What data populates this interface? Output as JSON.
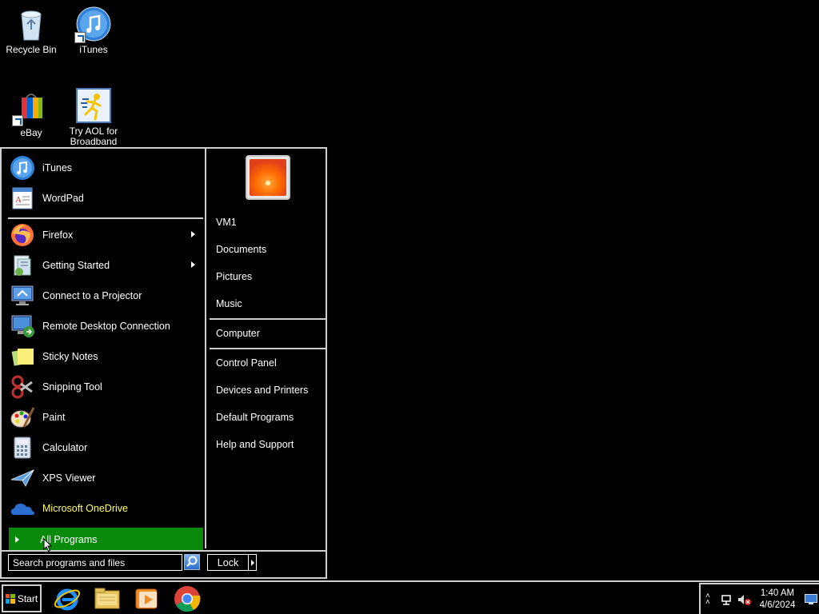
{
  "desktop": {
    "icons": [
      {
        "label": "Recycle Bin",
        "icon": "recycle-bin-icon"
      },
      {
        "label": "iTunes",
        "icon": "itunes-icon"
      },
      {
        "label": "eBay",
        "icon": "ebay-icon"
      },
      {
        "label": "Try AOL for Broadband",
        "icon": "aol-icon"
      }
    ]
  },
  "start_menu": {
    "pinned": [
      {
        "label": "iTunes",
        "icon": "itunes-icon"
      },
      {
        "label": "WordPad",
        "icon": "wordpad-icon"
      }
    ],
    "recent": [
      {
        "label": "Firefox",
        "icon": "firefox-icon",
        "submenu": true
      },
      {
        "label": "Getting Started",
        "icon": "getting-started-icon",
        "submenu": true
      },
      {
        "label": "Connect to a Projector",
        "icon": "projector-icon",
        "submenu": false
      },
      {
        "label": "Remote Desktop Connection",
        "icon": "remote-desktop-icon",
        "submenu": false
      },
      {
        "label": "Sticky Notes",
        "icon": "sticky-notes-icon",
        "submenu": false
      },
      {
        "label": "Snipping Tool",
        "icon": "snipping-tool-icon",
        "submenu": false
      },
      {
        "label": "Paint",
        "icon": "paint-icon",
        "submenu": false
      },
      {
        "label": "Calculator",
        "icon": "calculator-icon",
        "submenu": false
      },
      {
        "label": "XPS Viewer",
        "icon": "xps-viewer-icon",
        "submenu": false
      },
      {
        "label": "Microsoft OneDrive",
        "icon": "onedrive-icon",
        "submenu": false,
        "highlight_color": "#ffff66"
      }
    ],
    "all_programs_label": "All Programs",
    "search_placeholder": "Search programs and files",
    "right_links_group1": [
      "VM1",
      "Documents",
      "Pictures",
      "Music"
    ],
    "right_links_group2": [
      "Computer"
    ],
    "right_links_group3": [
      "Control Panel",
      "Devices and Printers",
      "Default Programs",
      "Help and Support"
    ],
    "lock_label": "Lock"
  },
  "taskbar": {
    "start_label": "Start",
    "apps": [
      "internet-explorer-icon",
      "file-explorer-icon",
      "media-player-icon",
      "chrome-icon"
    ],
    "clock_time": "1:40 AM",
    "clock_date": "4/6/2024"
  },
  "colors": {
    "background": "#000000",
    "border": "#cfcfcf",
    "all_programs_bg": "#0a8a0a",
    "onedrive_label": "#ffff66"
  }
}
